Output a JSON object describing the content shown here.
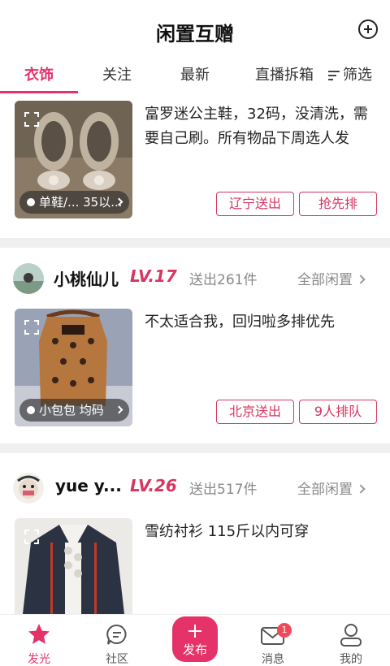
{
  "header": {
    "title": "闲置互赠"
  },
  "tabs": [
    {
      "label": "衣饰"
    },
    {
      "label": "关注"
    },
    {
      "label": "最新"
    },
    {
      "label": "直播拆箱"
    },
    {
      "label": "筛选"
    }
  ],
  "cards": [
    {
      "desc": "富罗迷公主鞋，32码，没清洗，需要自己刷。所有物品下周选人发",
      "caption": "单鞋/... 35以...",
      "chips": [
        "辽宁送出",
        "抢先排"
      ]
    },
    {
      "user": {
        "name": "小桃仙儿",
        "level": "LV.17",
        "sent": "送出261件",
        "all": "全部闲置"
      },
      "desc": "不太适合我，回归啦多排优先",
      "caption": "小包包 均码",
      "chips": [
        "北京送出",
        "9人排队"
      ]
    },
    {
      "user": {
        "name": "yue y...",
        "level": "LV.26",
        "sent": "送出517件",
        "all": "全部闲置"
      },
      "desc": "雪纺衬衫 115斤以内可穿"
    }
  ],
  "bottom_nav": [
    {
      "label": "发光",
      "icon": "star-icon"
    },
    {
      "label": "社区",
      "icon": "chat-icon"
    },
    {
      "label": "发布",
      "icon": "plus-icon"
    },
    {
      "label": "消息",
      "icon": "mail-icon",
      "badge": "1"
    },
    {
      "label": "我的",
      "icon": "person-icon"
    }
  ],
  "colors": {
    "accent": "#e5336a",
    "level": "#d83560",
    "divider": "#f0f0f0"
  }
}
